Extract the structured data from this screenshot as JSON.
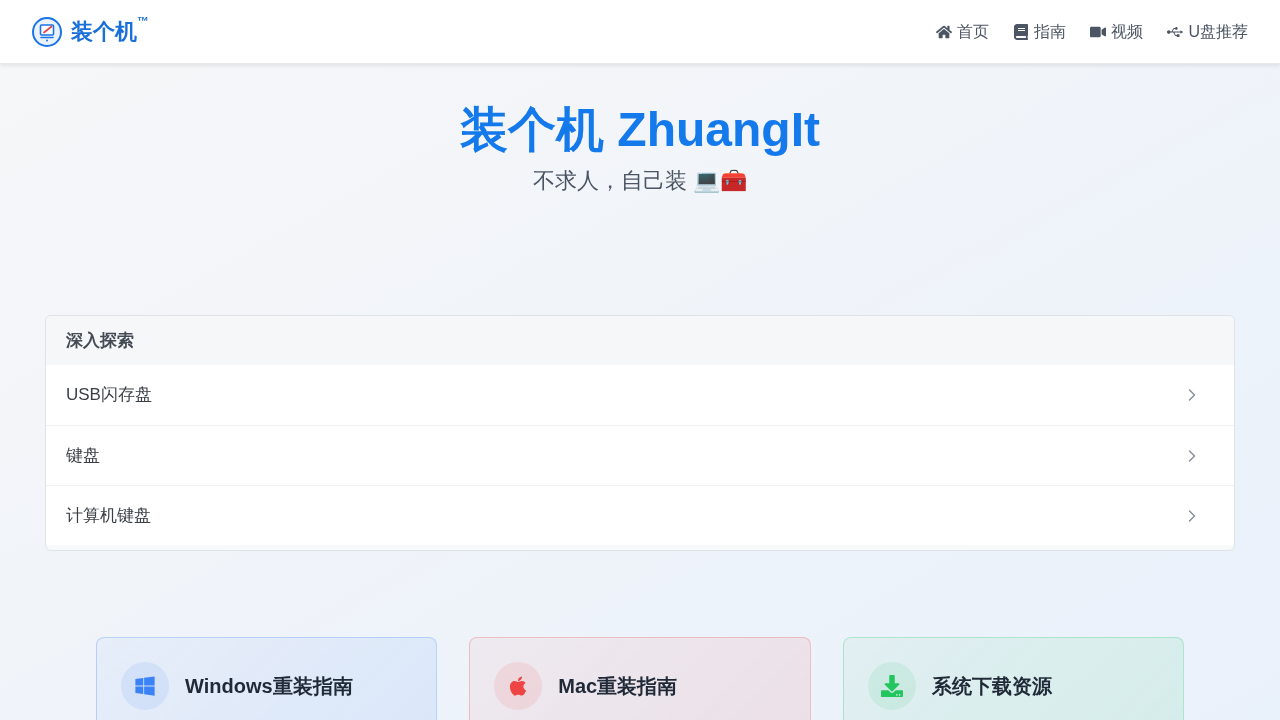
{
  "header": {
    "logo": "装个机$^{™}$",
    "nav": [
      {
        "label": "首页"
      },
      {
        "label": "指南"
      },
      {
        "label": "视频"
      },
      {
        "label": "U盘推荐"
      }
    ]
  },
  "hero": {
    "title": "装个机 ZhuangIt",
    "subtitle": "不求人，自己装 💻🧰"
  },
  "explore": {
    "title": "深入探索",
    "items": [
      "USB闪存盘",
      "键盘",
      "计算机键盘"
    ]
  },
  "cards": [
    {
      "title": "Windows重装指南",
      "color": "#3b82f6"
    },
    {
      "title": "Mac重装指南",
      "color": "#ef4444"
    },
    {
      "title": "系统下载资源",
      "color": "#22c55e"
    }
  ]
}
